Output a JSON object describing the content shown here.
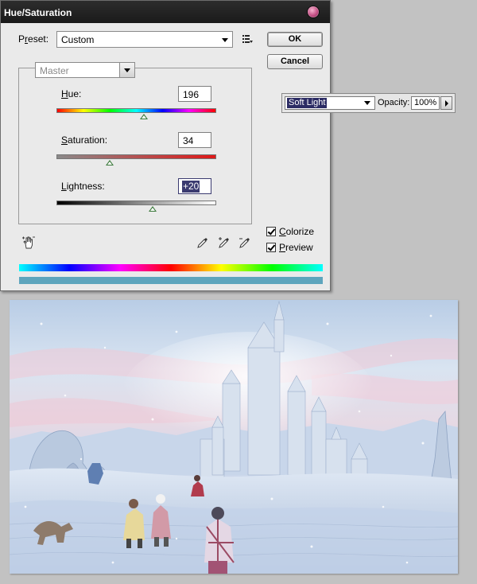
{
  "dialog": {
    "title": "Hue/Saturation",
    "preset": {
      "label_pre": "P",
      "label_u": "r",
      "label_post": "eset:",
      "value": "Custom"
    },
    "ok_label": "OK",
    "cancel_label": "Cancel",
    "channel": "Master",
    "hue": {
      "label_pre": "",
      "label_u": "H",
      "label_post": "ue:",
      "value": "196",
      "fraction": 0.545
    },
    "saturation": {
      "label_pre": "",
      "label_u": "S",
      "label_post": "aturation:",
      "value": "34",
      "fraction": 0.335
    },
    "lightness": {
      "label_pre": "",
      "label_u": "L",
      "label_post": "ightness:",
      "value": "+20",
      "fraction": 0.6
    },
    "colorize": {
      "label_pre": "",
      "label_u": "C",
      "label_post": "olorize",
      "checked": true
    },
    "preview": {
      "label_pre": "",
      "label_u": "P",
      "label_post": "review",
      "checked": true
    },
    "result_color": "#5ea5bd"
  },
  "layer_panel": {
    "blend_mode": "Soft Light",
    "opacity_label": "Opacity:",
    "opacity_value": "100%"
  },
  "icons": {
    "preset_options": "list-options-icon",
    "hand_tool": "hand-adjust-icon",
    "eyedropper": "eyedropper-icon",
    "eyedropper_plus": "eyedropper-add-icon",
    "eyedropper_minus": "eyedropper-subtract-icon"
  },
  "canvas": {
    "description_hidden": true
  }
}
